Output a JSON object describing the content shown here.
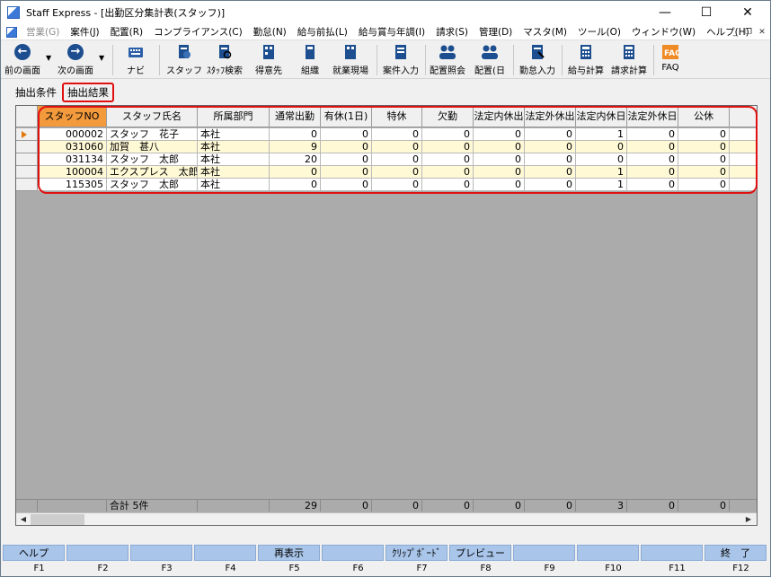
{
  "window": {
    "title": "Staff Express - [出勤区分集計表(スタッフ)]"
  },
  "menu": [
    "営業(G)",
    "案件(J)",
    "配置(R)",
    "コンプライアンス(C)",
    "勤怠(N)",
    "給与前払(L)",
    "給与賞与年調(I)",
    "請求(S)",
    "管理(D)",
    "マスタ(M)",
    "ツール(O)",
    "ウィンドウ(W)",
    "ヘルプ(H)"
  ],
  "toolbar": {
    "prev": "前の画面",
    "next": "次の画面",
    "navi": "ナビ",
    "staff": "スタッフ",
    "staff_search": "ｽﾀｯﾌ検索",
    "client": "得意先",
    "org": "組織",
    "worksite": "就業現場",
    "case_input": "案件入力",
    "assign_inquiry": "配置照会",
    "assign_day": "配置(日",
    "attendance_input": "勤怠入力",
    "payroll": "給与計算",
    "billing": "請求計算",
    "faq": "FAQ"
  },
  "tabs": {
    "conditions": "抽出条件",
    "results": "抽出結果"
  },
  "table": {
    "headers": [
      "スタッフNO",
      "スタッフ氏名",
      "所属部門",
      "通常出勤",
      "有休(1日)",
      "特休",
      "欠勤",
      "法定内休出",
      "法定外休出",
      "法定内休日",
      "法定外休日",
      "公休"
    ],
    "rows": [
      [
        "000002",
        "スタッフ　花子",
        "本社",
        "0",
        "0",
        "0",
        "0",
        "0",
        "0",
        "1",
        "0",
        "0"
      ],
      [
        "031060",
        "加賀　甚八",
        "本社",
        "9",
        "0",
        "0",
        "0",
        "0",
        "0",
        "0",
        "0",
        "0"
      ],
      [
        "031134",
        "スタッフ　太郎",
        "本社",
        "20",
        "0",
        "0",
        "0",
        "0",
        "0",
        "0",
        "0",
        "0"
      ],
      [
        "100004",
        "エクスプレス　太郎",
        "本社",
        "0",
        "0",
        "0",
        "0",
        "0",
        "0",
        "1",
        "0",
        "0"
      ],
      [
        "115305",
        "スタッフ　太郎",
        "本社",
        "0",
        "0",
        "0",
        "0",
        "0",
        "0",
        "1",
        "0",
        "0"
      ]
    ],
    "footer": {
      "label": "合計 5件",
      "values": [
        "29",
        "0",
        "0",
        "0",
        "0",
        "0",
        "3",
        "0",
        "0"
      ]
    }
  },
  "fkeys": [
    {
      "label": "ヘルプ",
      "key": "F1"
    },
    {
      "label": "",
      "key": "F2"
    },
    {
      "label": "",
      "key": "F3"
    },
    {
      "label": "",
      "key": "F4"
    },
    {
      "label": "再表示",
      "key": "F5"
    },
    {
      "label": "",
      "key": "F6"
    },
    {
      "label": "ｸﾘｯﾌﾟﾎﾞｰﾄﾞ",
      "key": "F7"
    },
    {
      "label": "プレビュー",
      "key": "F8"
    },
    {
      "label": "",
      "key": "F9"
    },
    {
      "label": "",
      "key": "F10"
    },
    {
      "label": "",
      "key": "F11"
    },
    {
      "label": "終　了",
      "key": "F12"
    }
  ]
}
